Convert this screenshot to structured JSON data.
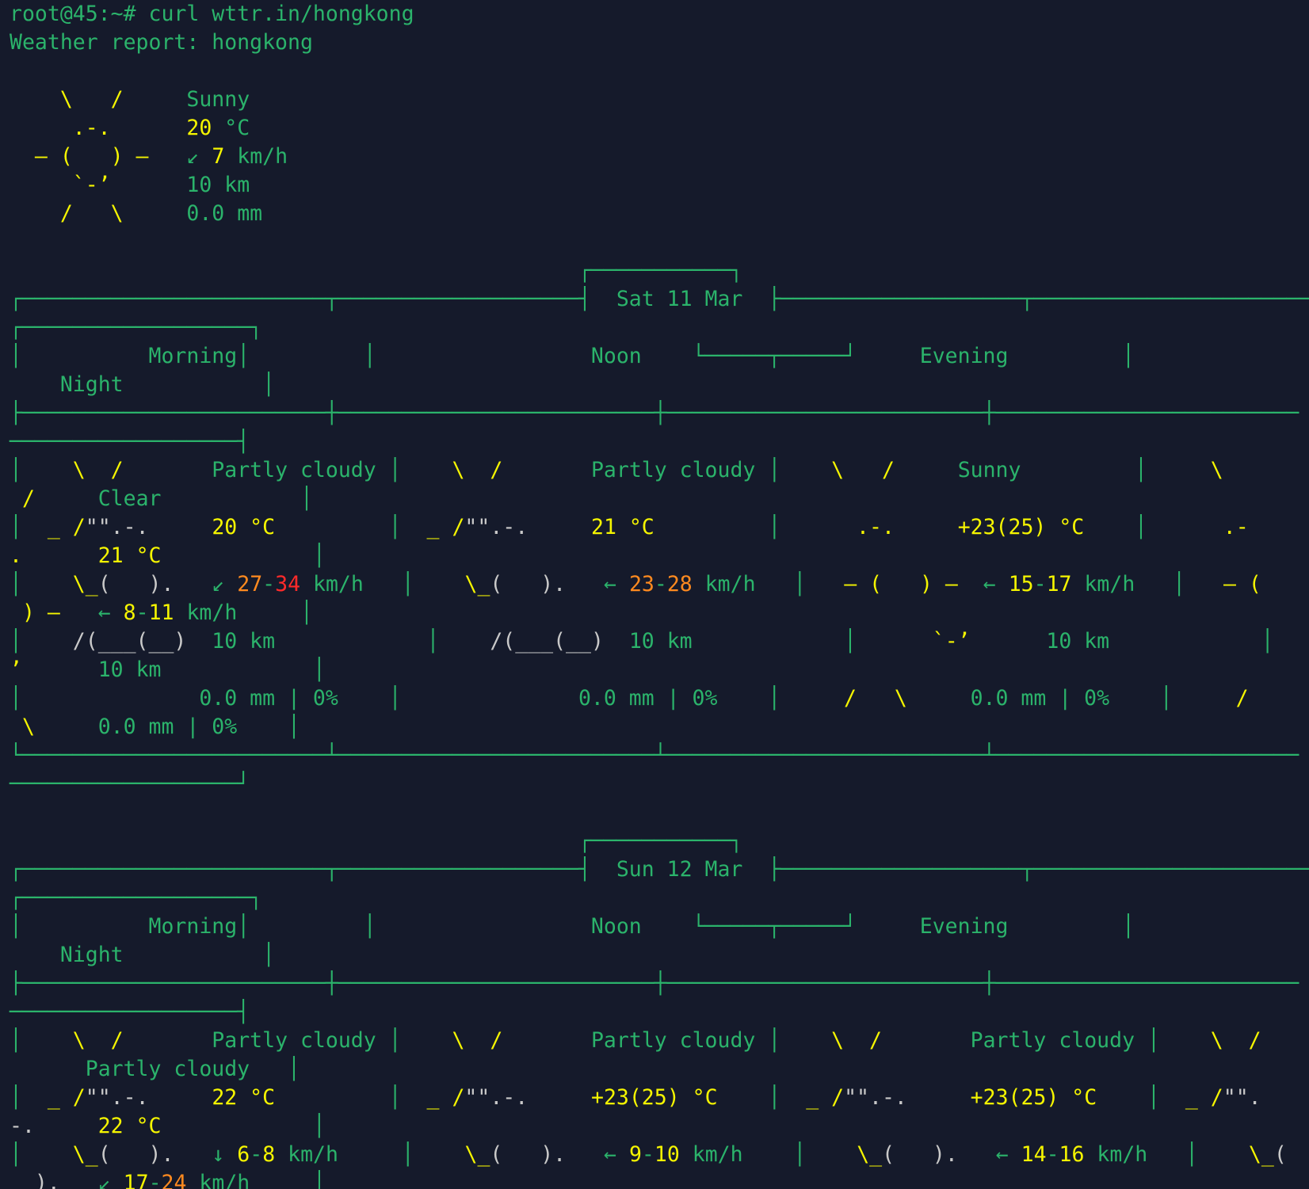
{
  "terminal": {
    "prompt": "root@45:~# ",
    "command": "curl wttr.in/hongkong",
    "title_line": "Weather report: hongkong"
  },
  "current": {
    "condition": "Sunny",
    "temp": "20",
    "temp_unit": " °C",
    "wind_arrow": "↙",
    "wind_speed": "7",
    "wind_unit": " km/h",
    "visibility": "10 km",
    "precip": "0.0 mm"
  },
  "days": [
    {
      "date": "Sat 11 Mar",
      "periods": [
        {
          "name": "Morning",
          "condition": "Partly cloudy",
          "temp": "20 °C",
          "wind_arrow": "↙",
          "wind_lo": "27",
          "wind_hi": "34",
          "wind_unit": " km/h",
          "visibility": "10 km",
          "precip": "0.0 mm | 0%"
        },
        {
          "name": "Noon",
          "condition": "Partly cloudy",
          "temp": "21 °C",
          "wind_arrow": "←",
          "wind_lo": "23",
          "wind_hi": "28",
          "wind_unit": " km/h",
          "visibility": "10 km",
          "precip": "0.0 mm | 0%"
        },
        {
          "name": "Evening",
          "condition": "Sunny",
          "temp": "+23(25) °C",
          "wind_arrow": "←",
          "wind_lo": "15",
          "wind_hi": "17",
          "wind_unit": " km/h",
          "visibility": "10 km",
          "precip": "0.0 mm | 0%"
        },
        {
          "name": "Night",
          "condition": "Clear",
          "temp": "21 °C",
          "wind_arrow": "←",
          "wind_lo": "8",
          "wind_hi": "11",
          "wind_unit": " km/h",
          "visibility": "10 km",
          "precip": "0.0 mm | 0%"
        }
      ]
    },
    {
      "date": "Sun 12 Mar",
      "periods": [
        {
          "name": "Morning",
          "condition": "Partly cloudy",
          "temp": "22 °C",
          "wind_arrow": "↓",
          "wind_lo": "6",
          "wind_hi": "8",
          "wind_unit": " km/h"
        },
        {
          "name": "Noon",
          "condition": "Partly cloudy",
          "temp": "+23(25) °C",
          "wind_arrow": "←",
          "wind_lo": "9",
          "wind_hi": "10",
          "wind_unit": " km/h"
        },
        {
          "name": "Evening",
          "condition": "Partly cloudy",
          "temp": "+23(25) °C",
          "wind_arrow": "←",
          "wind_lo": "14",
          "wind_hi": "16",
          "wind_unit": " km/h"
        },
        {
          "name": "Night",
          "condition": "Partly cloudy",
          "temp": "22 °C",
          "wind_arrow": "↙",
          "wind_lo": "17",
          "wind_hi": "24",
          "wind_unit": " km/h"
        }
      ]
    }
  ],
  "colors": {
    "background": "#151a2b",
    "text_green": "#2bb36b",
    "sun_yellow": "#f5f500",
    "wind_orange": "#ff8a1f",
    "wind_red": "#ff2a2a",
    "cloud_gray": "#c9c9c9"
  }
}
